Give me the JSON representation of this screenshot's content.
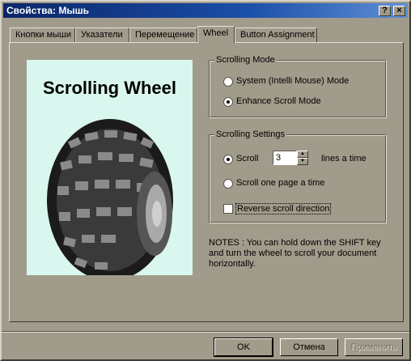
{
  "window": {
    "title": "Свойства: Мышь",
    "help_label": "?",
    "close_label": "×"
  },
  "tabs": [
    {
      "label": "Кнопки мыши"
    },
    {
      "label": "Указатели"
    },
    {
      "label": "Перемещение"
    },
    {
      "label": "Wheel"
    },
    {
      "label": "Button Assignment"
    }
  ],
  "picture": {
    "title": "Scrolling Wheel"
  },
  "scrolling_mode": {
    "legend": "Scrolling Mode",
    "option_intellimouse": "System (Intelli Mouse) Mode",
    "option_enhance": "Enhance Scroll Mode",
    "selected": "Enhance Scroll Mode"
  },
  "scrolling_settings": {
    "legend": "Scrolling Settings",
    "option_scroll": "Scroll",
    "lines_value": "3",
    "lines_suffix": "lines a time",
    "option_page": "Scroll one page a time",
    "reverse_label": "Reverse scroll direction",
    "reverse_checked": false
  },
  "notes": "NOTES : You can hold down the SHIFT key and turn the wheel to scroll your document horizontally.",
  "buttons": {
    "ok": "OK",
    "cancel": "Отмена",
    "apply": "Применить"
  },
  "colors": {
    "titlebar_start": "#0b2668",
    "titlebar_end": "#5f8fd6",
    "dialog_bg": "#a19b8b",
    "picture_bg": "#d9f7ee"
  }
}
